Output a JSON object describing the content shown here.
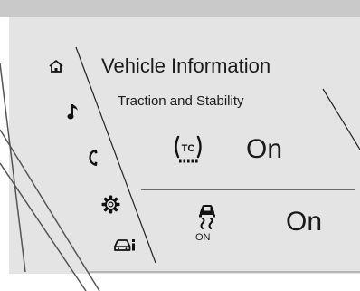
{
  "screen": {
    "title": "Vehicle Information",
    "subtitle": "Traction and Stability"
  },
  "nav": {
    "items": [
      {
        "icon": "home-icon"
      },
      {
        "icon": "music-note-icon"
      },
      {
        "icon": "phone-icon"
      },
      {
        "icon": "gear-icon"
      },
      {
        "icon": "vehicle-info-icon"
      }
    ]
  },
  "settings": {
    "traction_control": {
      "icon": "traction-control-icon",
      "status": "On"
    },
    "stability_control": {
      "icon": "stability-control-icon",
      "caption": "ON",
      "status": "On"
    }
  }
}
